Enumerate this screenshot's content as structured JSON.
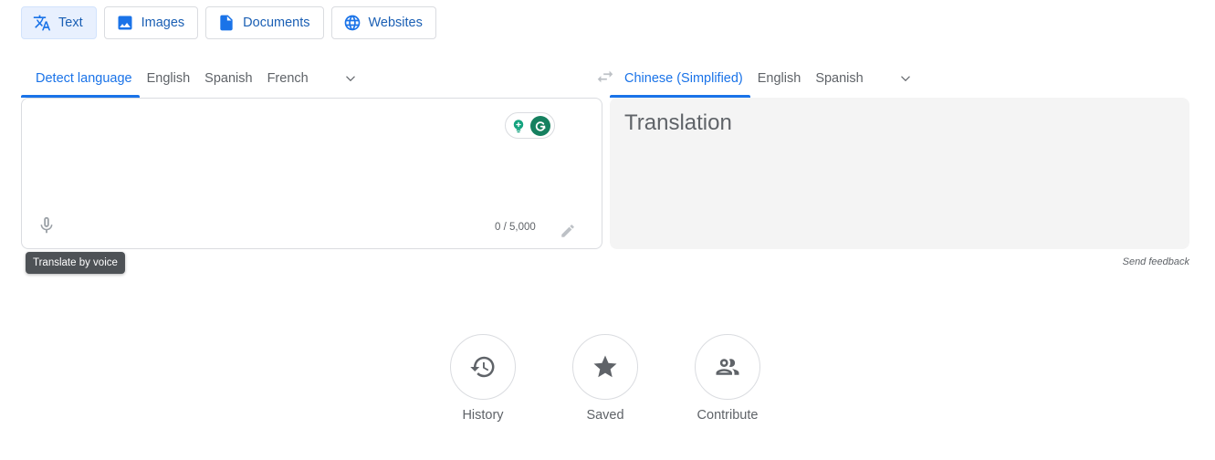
{
  "modes": [
    {
      "label": "Text",
      "icon": "translate-icon",
      "active": true
    },
    {
      "label": "Images",
      "icon": "image-icon",
      "active": false
    },
    {
      "label": "Documents",
      "icon": "document-icon",
      "active": false
    },
    {
      "label": "Websites",
      "icon": "globe-icon",
      "active": false
    }
  ],
  "source": {
    "tabs": [
      "Detect language",
      "English",
      "Spanish",
      "French"
    ],
    "active_tab": "Detect language",
    "input_value": "",
    "char_count": "0 / 5,000",
    "mic_tooltip": "Translate by voice"
  },
  "target": {
    "tabs": [
      "Chinese (Simplified)",
      "English",
      "Spanish"
    ],
    "active_tab": "Chinese (Simplified)",
    "placeholder": "Translation",
    "feedback": "Send feedback"
  },
  "actions": [
    {
      "label": "History",
      "icon": "history-icon"
    },
    {
      "label": "Saved",
      "icon": "star-icon"
    },
    {
      "label": "Contribute",
      "icon": "people-icon"
    }
  ],
  "colors": {
    "accent": "#1a73e8",
    "grammarly": "#15805f"
  }
}
